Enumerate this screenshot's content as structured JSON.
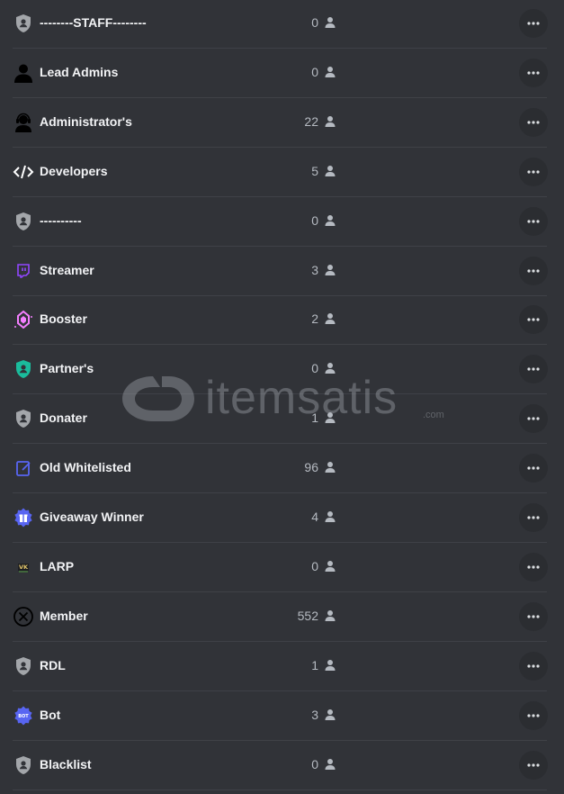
{
  "roles": [
    {
      "name": "--------STAFF--------",
      "count": "0",
      "icon": "shield-user-icon",
      "color": "#a3a6aa"
    },
    {
      "name": "Lead Admins",
      "count": "0",
      "icon": "person-silhouette-icon",
      "color": "#000000"
    },
    {
      "name": "Administrator's",
      "count": "22",
      "icon": "headset-agent-icon",
      "color": "#000000"
    },
    {
      "name": "Developers",
      "count": "5",
      "icon": "code-brackets-icon",
      "color": "#ffffff"
    },
    {
      "name": "----------",
      "count": "0",
      "icon": "shield-user-icon",
      "color": "#a3a6aa"
    },
    {
      "name": "Streamer",
      "count": "3",
      "icon": "twitch-icon",
      "color": "#9146ff"
    },
    {
      "name": "Booster",
      "count": "2",
      "icon": "nitro-gem-icon",
      "color": "#f47fff"
    },
    {
      "name": "Partner's",
      "count": "0",
      "icon": "shield-user-icon",
      "color": "#1abc9c"
    },
    {
      "name": "Donater",
      "count": "1",
      "icon": "shield-user-icon",
      "color": "#a3a6aa"
    },
    {
      "name": "Old Whitelisted",
      "count": "96",
      "icon": "edit-note-icon",
      "color": "#5865f2"
    },
    {
      "name": "Giveaway Winner",
      "count": "4",
      "icon": "gift-badge-icon",
      "color": "#5865f2"
    },
    {
      "name": "LARP",
      "count": "0",
      "icon": "larp-emblem-icon",
      "color": "#e0c36a"
    },
    {
      "name": "Member",
      "count": "552",
      "icon": "circle-x-icon",
      "color": "#000000"
    },
    {
      "name": "RDL",
      "count": "1",
      "icon": "shield-user-icon",
      "color": "#a3a6aa"
    },
    {
      "name": "Bot",
      "count": "3",
      "icon": "bot-badge-icon",
      "color": "#5865f2"
    },
    {
      "name": "Blacklist",
      "count": "0",
      "icon": "shield-user-icon",
      "color": "#a3a6aa"
    }
  ],
  "watermark": {
    "text": "itemsatis",
    "suffix": ".com"
  }
}
